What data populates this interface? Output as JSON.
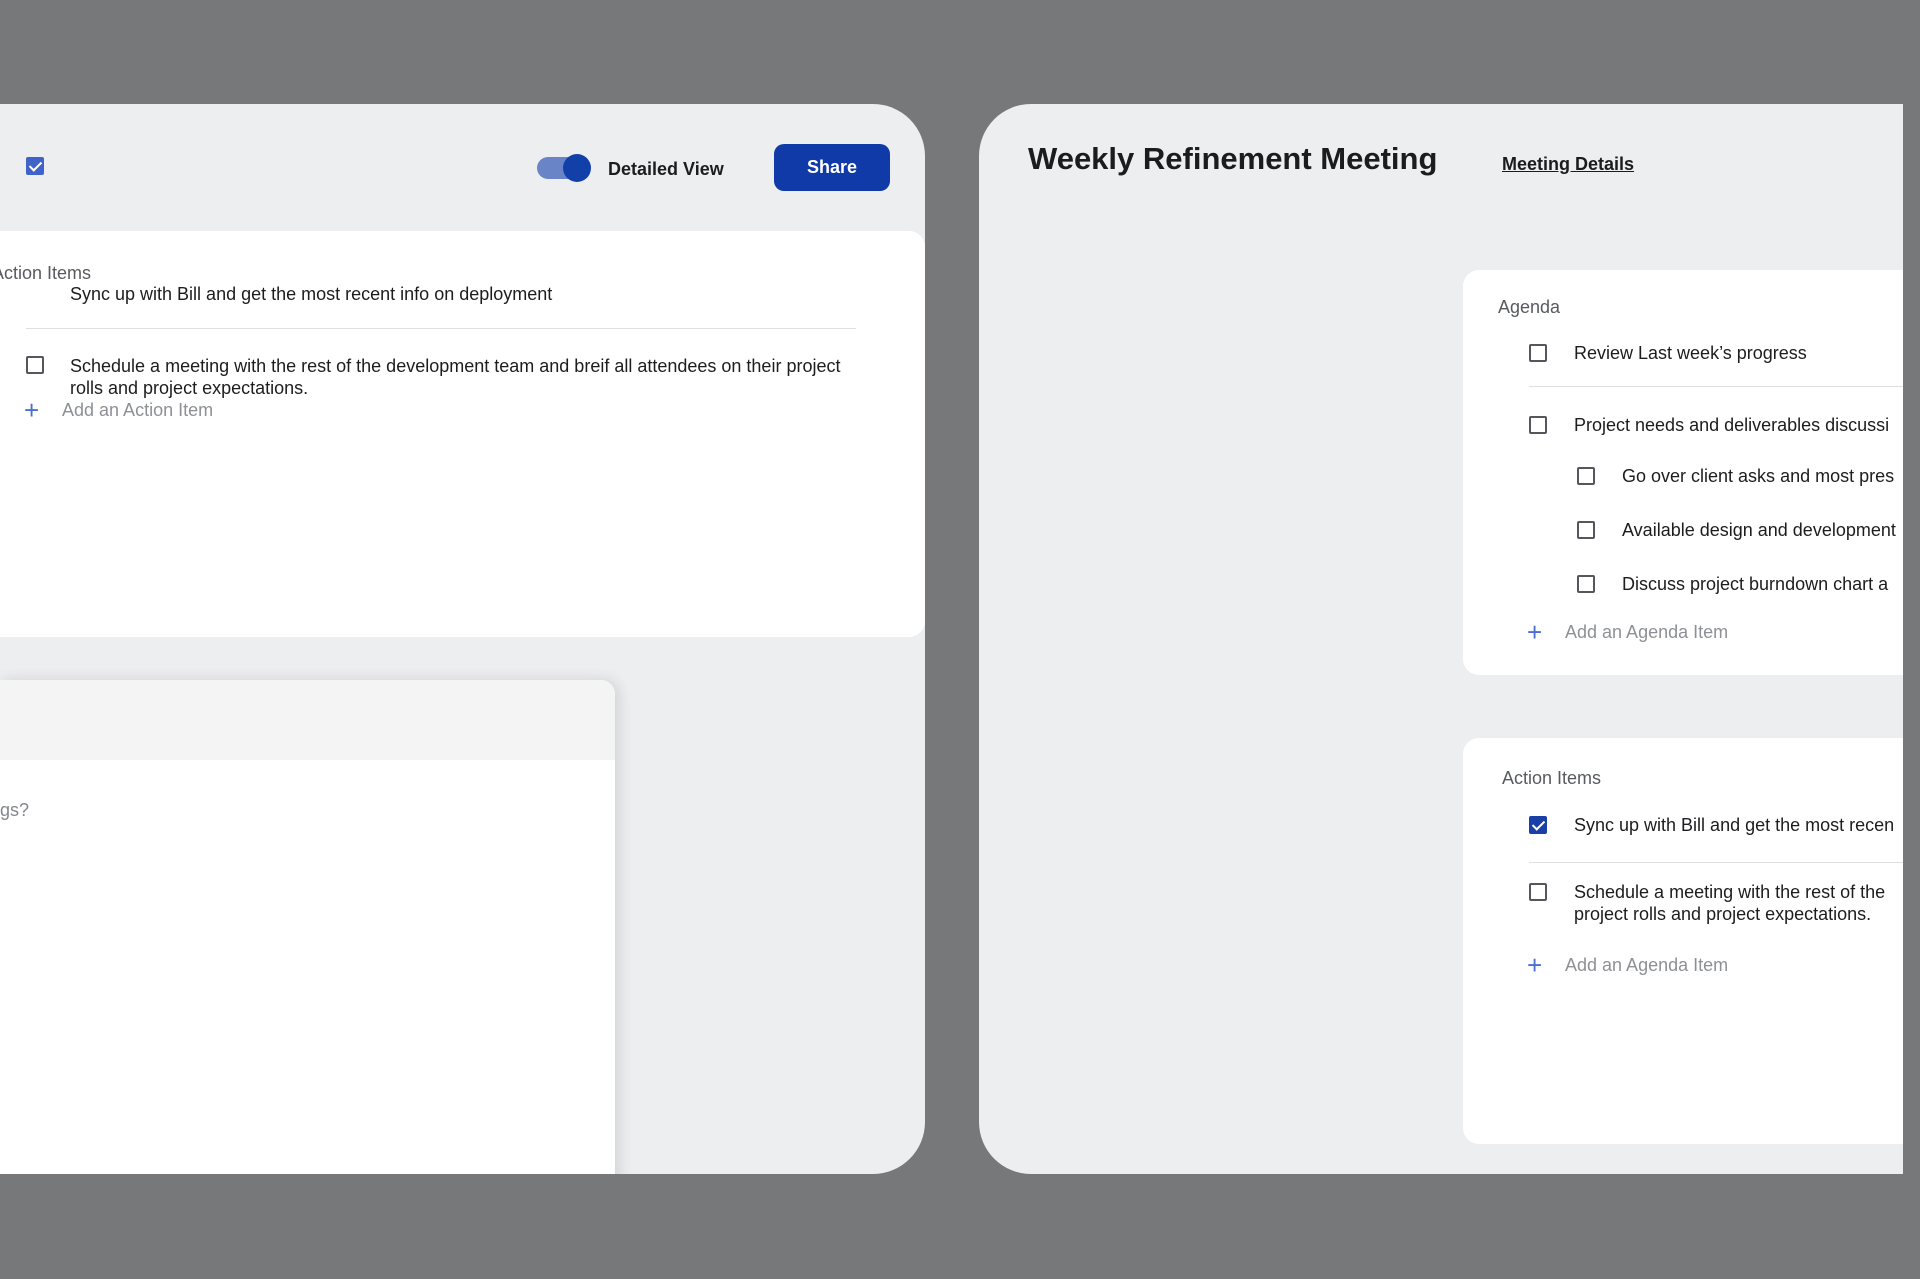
{
  "left_panel": {
    "toggle_label": "Detailed View",
    "share_label": "Share",
    "action_items": {
      "title": "Action Items",
      "items": [
        {
          "text": "Sync up with Bill and get the most recent info on deployment",
          "checked": true
        },
        {
          "text": "Schedule a meeting with the rest of the development team and breif all attendees on their project rolls and project expectations.",
          "checked": false
        }
      ],
      "add_label": "Add an Action Item"
    },
    "notes": {
      "partial_text": "gs?"
    }
  },
  "right_panel": {
    "title": "Weekly Refinement Meeting",
    "details_link": "Meeting Details",
    "agenda": {
      "title": "Agenda",
      "items": [
        {
          "text": "Review Last week’s progress",
          "checked": false
        },
        {
          "text": "Project needs and deliverables discussi",
          "checked": false
        },
        {
          "text": "Go over client asks and most pres",
          "checked": false
        },
        {
          "text": "Available design and development",
          "checked": false
        },
        {
          "text": "Discuss project burndown chart a",
          "checked": false
        }
      ],
      "add_label": "Add an Agenda Item"
    },
    "action_items": {
      "title": "Action Items",
      "items": [
        {
          "text": "Sync up with Bill and get the most recen",
          "checked": true
        },
        {
          "text": "Schedule a meeting with the rest of the",
          "text_line2": "project rolls and project expectations.",
          "checked": false
        }
      ],
      "add_label": "Add an Agenda Item"
    }
  },
  "colors": {
    "accent": "#0f3aa8",
    "background": "#77787a",
    "panel": "#edeef0"
  }
}
